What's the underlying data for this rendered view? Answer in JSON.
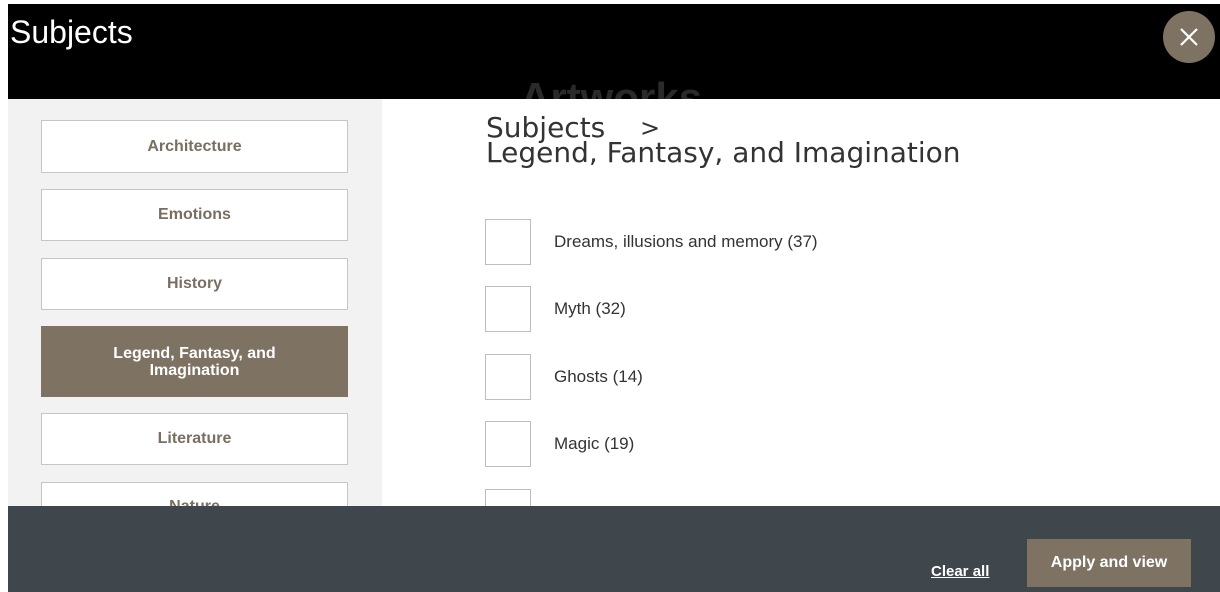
{
  "header": {
    "title": "Subjects",
    "background_text": "Artworks"
  },
  "close_button": {
    "icon": "close-icon",
    "glyph": "✕"
  },
  "sidebar": {
    "items": [
      {
        "label": "Architecture",
        "active": false
      },
      {
        "label": "Emotions",
        "active": false
      },
      {
        "label": "History",
        "active": false
      },
      {
        "label": "Legend, Fantasy, and Imagination",
        "active": true
      },
      {
        "label": "Literature",
        "active": false
      },
      {
        "label": "Nature",
        "active": false
      }
    ]
  },
  "breadcrumb": {
    "root": "Subjects",
    "separator": ">",
    "current": "Legend, Fantasy, and Imagination"
  },
  "options": [
    {
      "label": "Dreams, illusions and memory (37)",
      "checked": false
    },
    {
      "label": "Myth (32)",
      "checked": false
    },
    {
      "label": "Ghosts (14)",
      "checked": false
    },
    {
      "label": "Magic (19)",
      "checked": false
    },
    {
      "label": "",
      "checked": false
    }
  ],
  "footer": {
    "clear_label": "Clear all",
    "apply_label": "Apply and view"
  },
  "colors": {
    "accent": "#7e7263",
    "header_bg": "#000000",
    "footer_bg": "#3f464c",
    "sidebar_bg": "#f2f2f2"
  }
}
